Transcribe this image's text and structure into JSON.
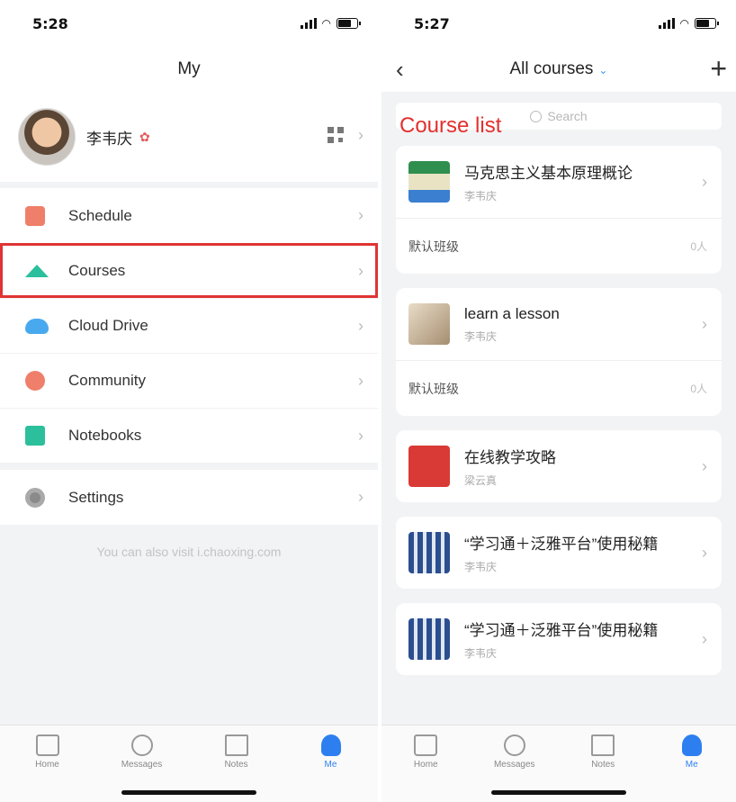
{
  "left": {
    "status": {
      "time": "5:28"
    },
    "nav": {
      "title": "My"
    },
    "profile": {
      "name": "李韦庆"
    },
    "menu": [
      {
        "label": "Schedule",
        "icon": "schedule-icon"
      },
      {
        "label": "Courses",
        "icon": "graduation-cap-icon"
      },
      {
        "label": "Cloud Drive",
        "icon": "cloud-icon"
      },
      {
        "label": "Community",
        "icon": "community-icon"
      },
      {
        "label": "Notebooks",
        "icon": "notebook-icon"
      }
    ],
    "settings": {
      "label": "Settings",
      "icon": "gear-icon"
    },
    "footer_note": "You can also visit i.chaoxing.com",
    "tabs": [
      {
        "label": "Home"
      },
      {
        "label": "Messages"
      },
      {
        "label": "Notes"
      },
      {
        "label": "Me"
      }
    ]
  },
  "right": {
    "status": {
      "time": "5:27"
    },
    "nav": {
      "title": "All courses"
    },
    "search": {
      "placeholder": "Search"
    },
    "annotation": "Course list",
    "courses": [
      {
        "title": "马克思主义基本原理概论",
        "teacher": "李韦庆",
        "class_name": "默认班级",
        "class_count": "0人"
      },
      {
        "title": "learn a lesson",
        "teacher": "李韦庆",
        "class_name": "默认班级",
        "class_count": "0人"
      },
      {
        "title": "在线教学攻略",
        "teacher": "梁云真"
      },
      {
        "title": "“学习通＋泛雅平台”使用秘籍",
        "teacher": "李韦庆"
      },
      {
        "title": "“学习通＋泛雅平台”使用秘籍",
        "teacher": "李韦庆"
      }
    ],
    "tabs": [
      {
        "label": "Home"
      },
      {
        "label": "Messages"
      },
      {
        "label": "Notes"
      },
      {
        "label": "Me"
      }
    ]
  },
  "colors": {
    "accent": "#2d7ff0",
    "highlight_box": "#e03434",
    "annotation": "#e3302e"
  }
}
